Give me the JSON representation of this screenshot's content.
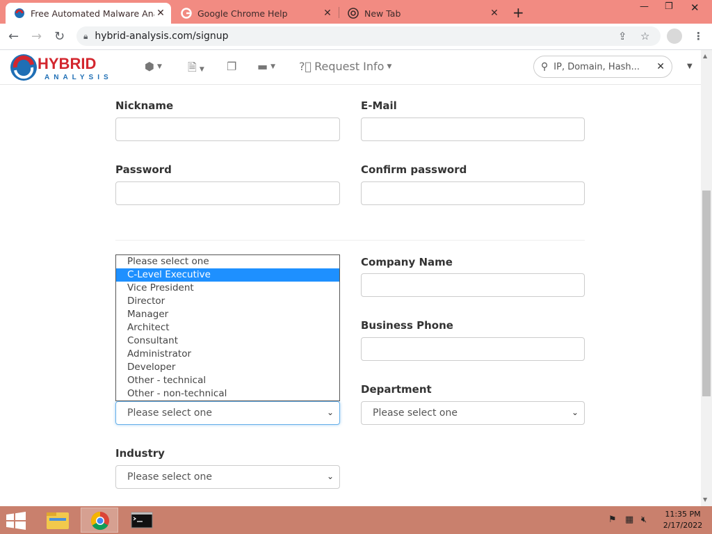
{
  "browser": {
    "tabs": [
      {
        "title": "Free Automated Malware Analysi",
        "active": true
      },
      {
        "title": "Google Chrome Help",
        "active": false
      },
      {
        "title": "New Tab",
        "active": false
      }
    ],
    "url": "hybrid-analysis.com/signup"
  },
  "site": {
    "logo": {
      "line1": "HYBRID",
      "line2": "ANALYSIS"
    },
    "nav": {
      "request_info": "Request Info"
    },
    "search_placeholder": "IP, Domain, Hash..."
  },
  "form": {
    "nickname_label": "Nickname",
    "email_label": "E-Mail",
    "password_label": "Password",
    "confirm_password_label": "Confirm password",
    "company_name_label": "Company Name",
    "business_phone_label": "Business Phone",
    "department_label": "Department",
    "industry_label": "Industry",
    "job_title_value": "Please select one",
    "department_value": "Please select one",
    "industry_value": "Please select one",
    "job_title_options": [
      "Please select one",
      "C-Level Executive",
      "Vice President",
      "Director",
      "Manager",
      "Architect",
      "Consultant",
      "Administrator",
      "Developer",
      "Other - technical",
      "Other - non-technical"
    ],
    "highlighted_option": "C-Level Executive"
  },
  "taskbar": {
    "time": "11:35 PM",
    "date": "2/17/2022"
  },
  "colors": {
    "tab_strip": "#f28b82",
    "taskbar": "#c9806d",
    "option_highlight": "#1e90ff",
    "logo_red": "#d3262e",
    "logo_blue": "#1f6fb5"
  }
}
